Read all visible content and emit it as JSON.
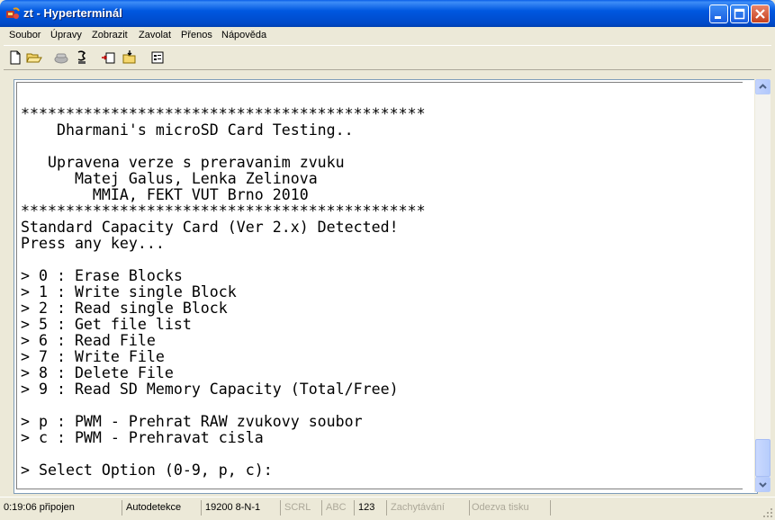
{
  "window": {
    "title": "zt - Hyperterminál"
  },
  "menu": [
    "Soubor",
    "Úpravy",
    "Zobrazit",
    "Zavolat",
    "Přenos",
    "Nápověda"
  ],
  "toolbar": {
    "icons": [
      "new-icon",
      "open-icon",
      "call-icon",
      "disconnect-icon",
      "send-icon",
      "receive-icon",
      "properties-icon"
    ]
  },
  "terminal": {
    "lines": [
      "*********************************************",
      "    Dharmani's microSD Card Testing..",
      "",
      "   Upravena verze s preravanim zvuku",
      "      Matej Galus, Lenka Zelinova",
      "        MMIA, FEKT VUT Brno 2010",
      "*********************************************",
      "Standard Capacity Card (Ver 2.x) Detected!",
      "Press any key...",
      "",
      "> 0 : Erase Blocks",
      "> 1 : Write single Block",
      "> 2 : Read single Block",
      "> 5 : Get file list",
      "> 6 : Read File",
      "> 7 : Write File",
      "> 8 : Delete File",
      "> 9 : Read SD Memory Capacity (Total/Free)",
      "",
      "> p : PWM - Prehrat RAW zvukovy soubor",
      "> c : PWM - Prehravat cisla",
      "",
      "> Select Option (0-9, p, c):"
    ]
  },
  "status": {
    "connected": "0:19:06 připojen",
    "detect": "Autodetekce",
    "settings": "19200 8-N-1",
    "scrl": "SCRL",
    "caps": "ABC",
    "num": "123",
    "capture": "Zachytávání",
    "echo": "Odezva tisku"
  }
}
